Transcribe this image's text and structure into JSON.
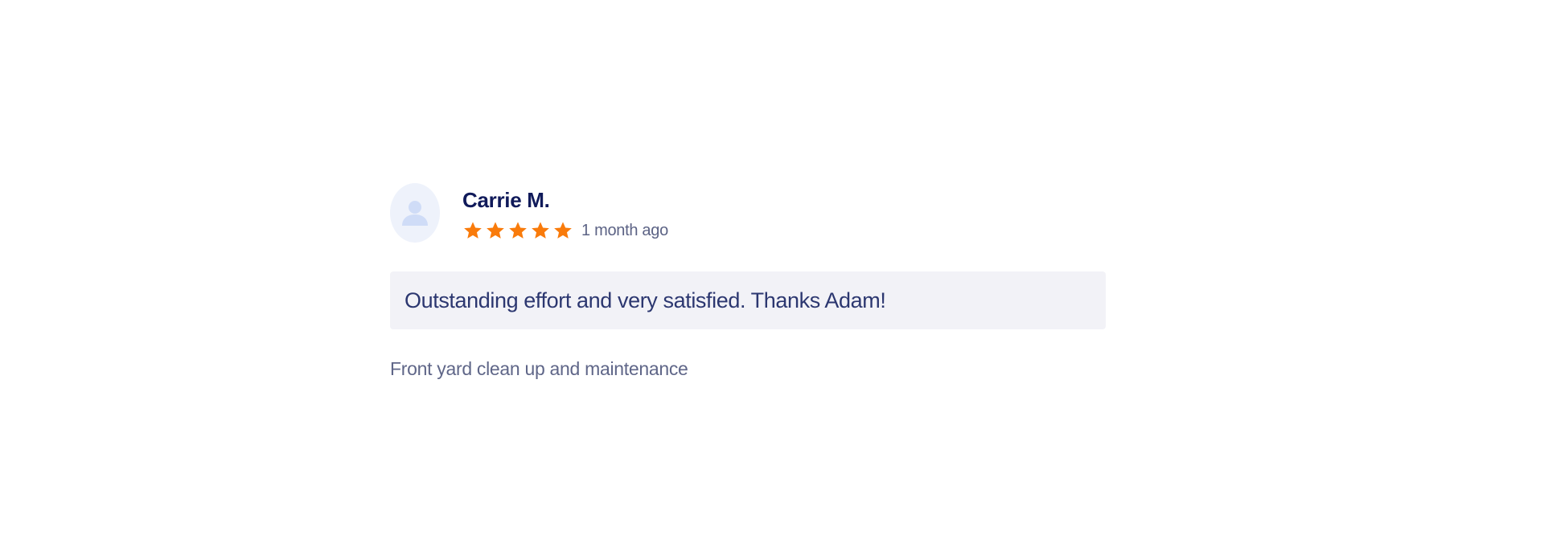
{
  "review": {
    "reviewer_name": "Carrie M.",
    "avatar_icon": "user-icon",
    "rating": 5,
    "rating_max": 5,
    "star_color": "#f97b0b",
    "time_ago": "1 month ago",
    "text": "Outstanding effort and very satisfied. Thanks Adam!",
    "service": "Front yard clean up and maintenance"
  }
}
